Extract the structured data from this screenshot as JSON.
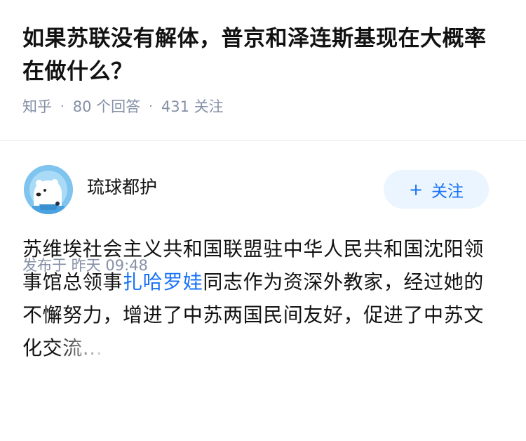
{
  "question": {
    "title": "如果苏联没有解体，普京和泽连斯基现在大概率在做什么？",
    "source": "知乎",
    "answer_count": "80 个回答",
    "follower_count": "431 关注",
    "separator": "·"
  },
  "answer": {
    "author": {
      "name": "琉球都护",
      "avatar_icon": "polar-bear-avatar"
    },
    "follow_button": {
      "icon": "+",
      "label": "关注"
    },
    "content": {
      "text_before_link": "苏维埃社会主义共和国联盟驻中华人民共和国沈阳领事馆总领事",
      "link_text": "扎哈罗娃",
      "text_after_link": "同志作为资深外教家，经过她的不懈努力，增进了中苏两国民间友好，促进了中苏文化",
      "faded_text": "交流..."
    },
    "publish_time": "发布于 昨天 09:48"
  },
  "colors": {
    "link": "#1772f6",
    "follow_bg": "#ebf5ff",
    "meta": "#8590a6",
    "avatar_bg": "#7fc4ef"
  }
}
